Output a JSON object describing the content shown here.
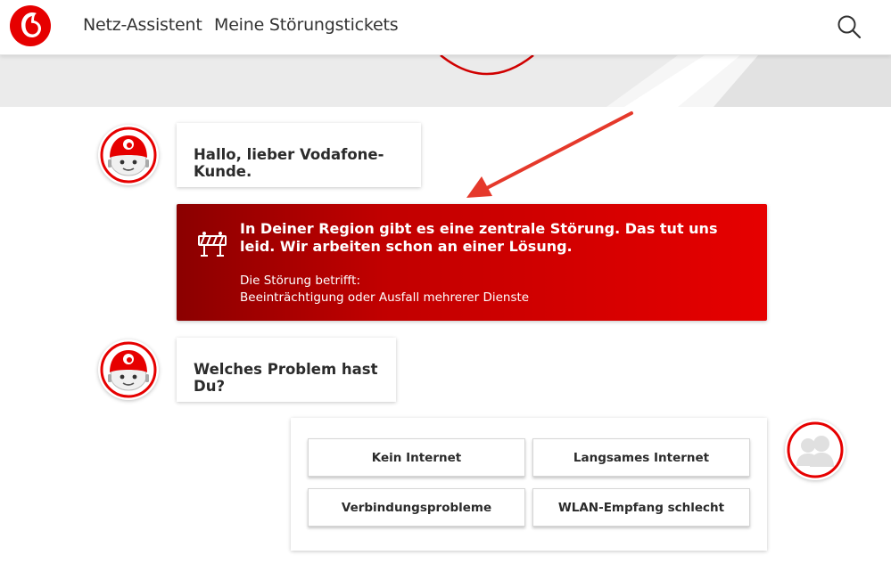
{
  "colors": {
    "brand": "#e60000",
    "alert_dark": "#8b0000",
    "text": "#2b2b2b"
  },
  "header": {
    "logo_icon": "vodafone-logo-icon",
    "nav": [
      "Netz-Assistent",
      "Meine Störungstickets"
    ],
    "search_icon": "search-icon"
  },
  "chat": {
    "greeting": "Hallo, lieber Vodafone-Kunde.",
    "alert": {
      "icon": "barrier-icon",
      "title": "In Deiner Region gibt es eine zentrale Störung. Das tut uns leid. Wir arbeiten schon an einer Lösung.",
      "affects_label": "Die Störung betrifft:",
      "affects_value": "Beeinträchtigung oder Ausfall mehrerer Dienste"
    },
    "question": "Welches Problem hast Du?",
    "options": [
      "Kein Internet",
      "Langsames Internet",
      "Verbindungsprobleme",
      "WLAN-Empfang schlecht"
    ]
  }
}
